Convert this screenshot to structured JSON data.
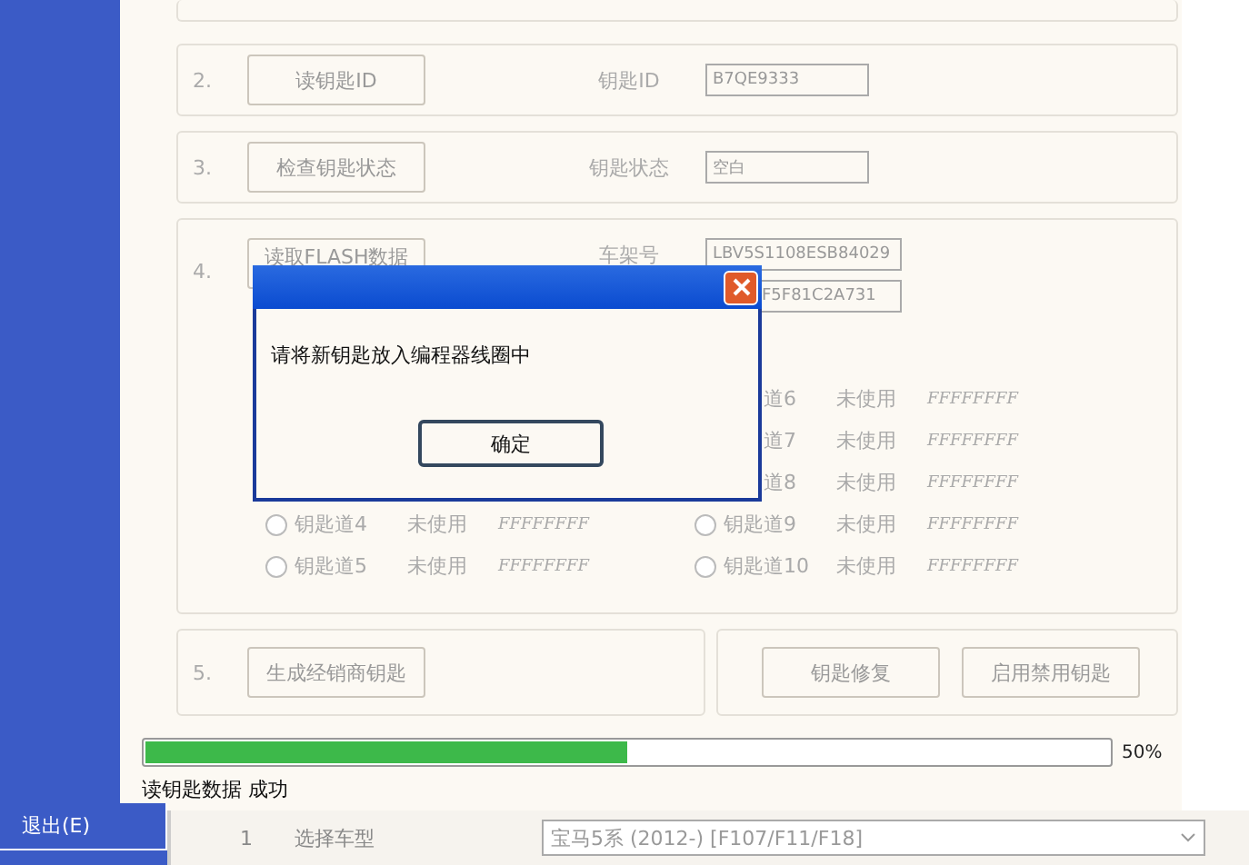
{
  "sidebar": {
    "exit_button": "退出(E)"
  },
  "steps": [
    {
      "kind": "field",
      "number": "2.",
      "button": "读钥匙ID",
      "label": "钥匙ID",
      "values": [
        "B7QE9333"
      ]
    },
    {
      "kind": "field",
      "number": "3.",
      "button": "检查钥匙状态",
      "label": "钥匙状态",
      "values": [
        "空白"
      ]
    },
    {
      "kind": "flash",
      "number": "4.",
      "button": "读取FLASH数据",
      "label": "车架号",
      "values": [
        "LBV5S1108ESB84029",
        "F5F81C2A731"
      ],
      "slots_left": [
        {
          "kind": "radio",
          "selected": false,
          "label": "钥匙道4",
          "status": "未使用",
          "value": "FFFFFFFF"
        },
        {
          "kind": "radio",
          "selected": false,
          "label": "钥匙道5",
          "status": "未使用",
          "value": "FFFFFFFF"
        }
      ],
      "slots_right": [
        {
          "kind": "cut",
          "label": "道6",
          "status": "未使用",
          "value": "FFFFFFFF"
        },
        {
          "kind": "cut",
          "label": "道7",
          "status": "未使用",
          "value": "FFFFFFFF"
        },
        {
          "kind": "cut",
          "label": "道8",
          "status": "未使用",
          "value": "FFFFFFFF"
        },
        {
          "kind": "radio",
          "selected": false,
          "label": "钥匙道9",
          "status": "未使用",
          "value": "FFFFFFFF"
        },
        {
          "kind": "radio",
          "selected": false,
          "label": "钥匙道10",
          "status": "未使用",
          "value": "FFFFFFFF"
        }
      ]
    },
    {
      "kind": "final",
      "number": "5.",
      "button": "生成经销商钥匙",
      "extra_buttons": [
        "钥匙修复",
        "启用禁用钥匙"
      ]
    }
  ],
  "progress": {
    "level": 0.5,
    "reading": "50%",
    "status": "读钥匙数据 成功"
  },
  "dialog": {
    "message": "请将新钥匙放入编程器线圈中",
    "ok_button": "确定"
  },
  "back_window": {
    "number": "1",
    "label": "选择车型",
    "select_value": "宝马5系 (2012-) [F107/F11/F18]"
  }
}
